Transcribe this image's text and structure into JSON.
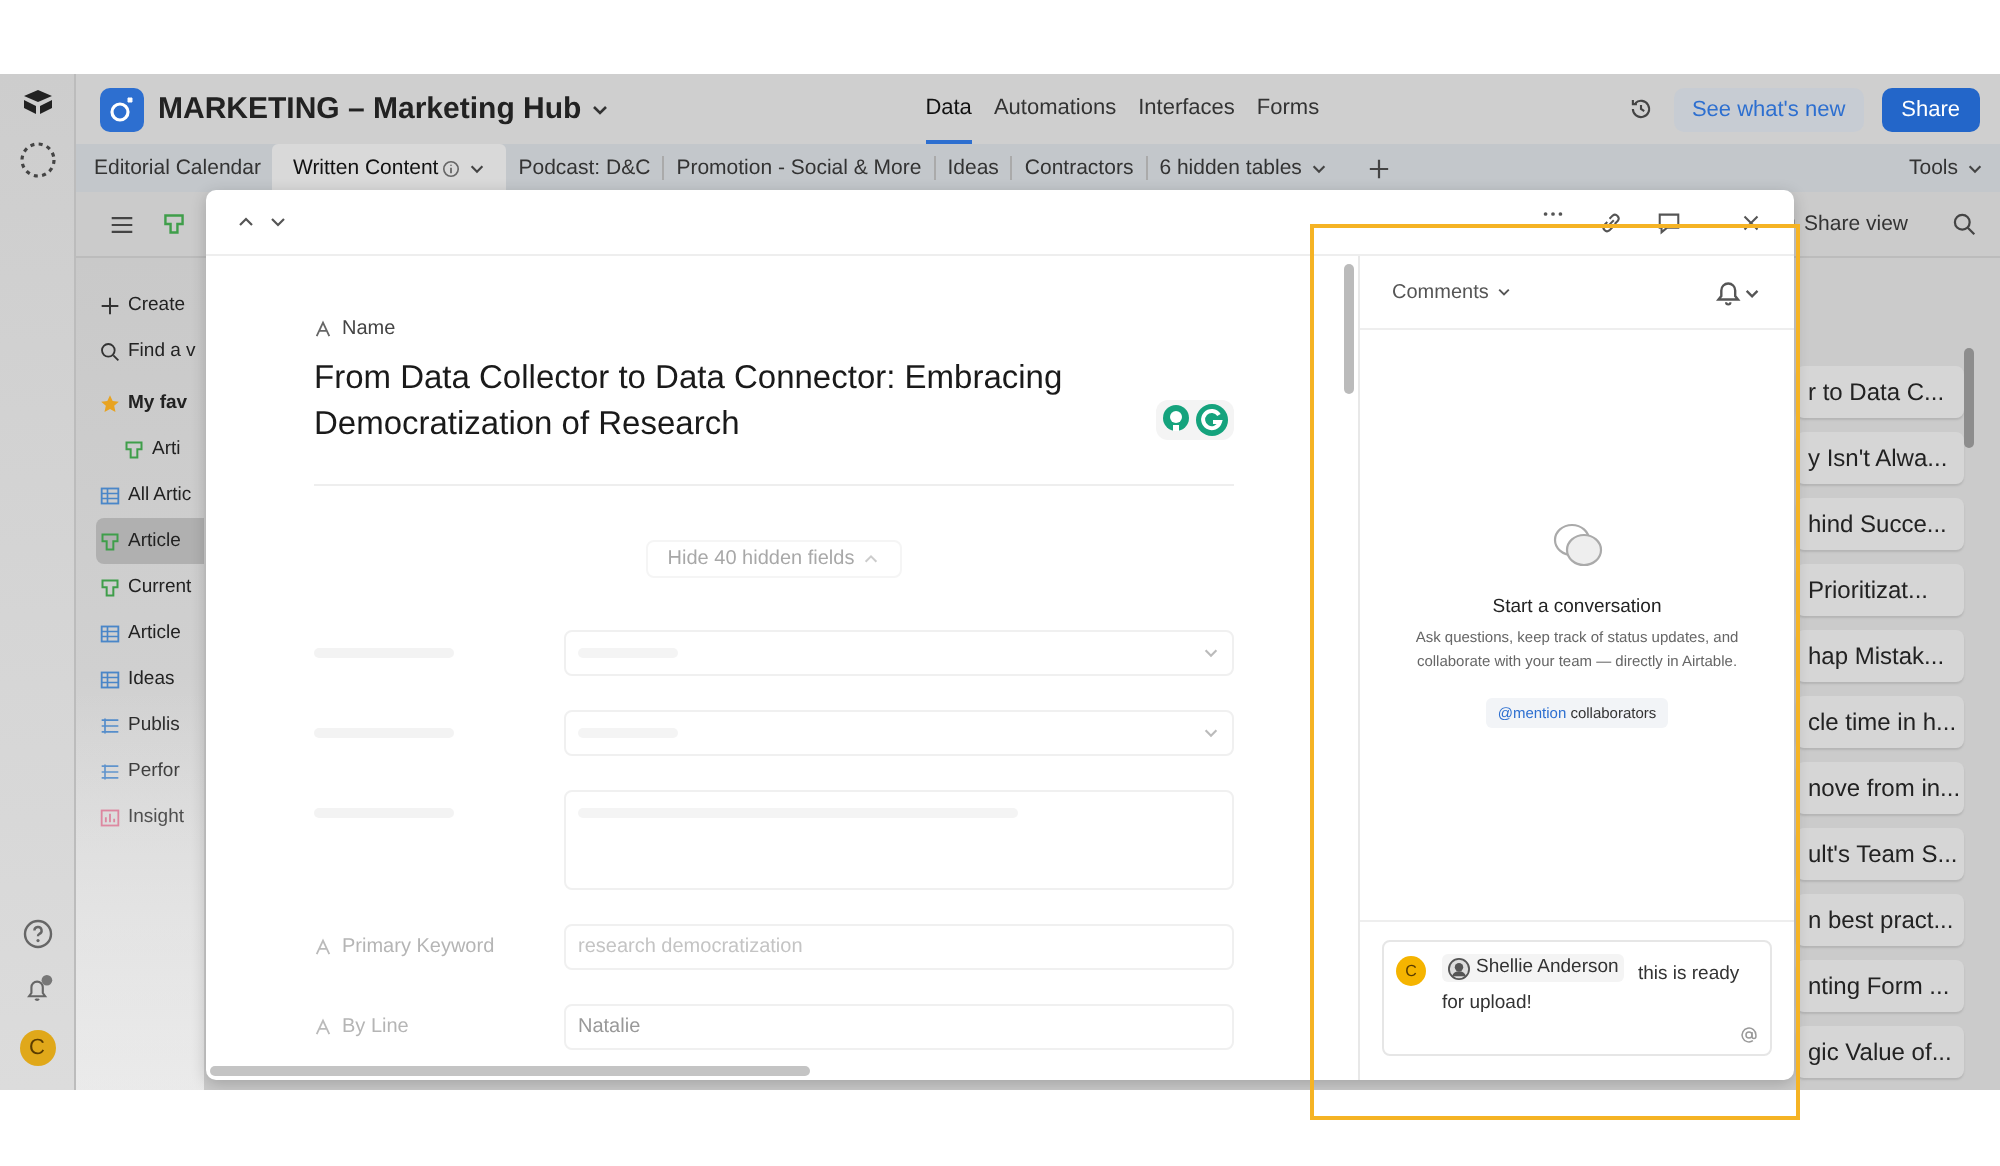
{
  "base": {
    "title": "MARKETING – Marketing Hub"
  },
  "nav": [
    {
      "label": "Data",
      "selected": true
    },
    {
      "label": "Automations",
      "selected": false
    },
    {
      "label": "Interfaces",
      "selected": false
    },
    {
      "label": "Forms",
      "selected": false
    }
  ],
  "header_buttons": {
    "whats_new": "See what's new",
    "share": "Share"
  },
  "tables": [
    {
      "label": "Editorial Calendar",
      "selected": false,
      "kind": "table"
    },
    {
      "label": "Written Content",
      "selected": true,
      "kind": "table"
    },
    {
      "label": "Podcast: D&C",
      "selected": false,
      "kind": "table"
    },
    {
      "label": "Promotion - Social & More",
      "selected": false,
      "kind": "table"
    },
    {
      "label": "Ideas",
      "selected": false,
      "kind": "table"
    },
    {
      "label": "Contractors",
      "selected": false,
      "kind": "table"
    },
    {
      "label": "6 hidden tables",
      "selected": false,
      "kind": "dropdown"
    }
  ],
  "tools": "Tools",
  "view_bar": {
    "share_view": "Share view"
  },
  "sidebar": [
    {
      "label": "Create",
      "kind": "create",
      "selected": false
    },
    {
      "label": "Find a v",
      "kind": "search",
      "selected": false
    },
    {
      "label": "My fav",
      "kind": "favorites",
      "selected": false,
      "children": [
        {
          "label": "Arti",
          "kind": "form",
          "selected": false
        }
      ]
    },
    {
      "label": "All Artic",
      "kind": "grid",
      "selected": false
    },
    {
      "label": "Article",
      "kind": "form",
      "selected": true
    },
    {
      "label": "Current",
      "kind": "form",
      "selected": false
    },
    {
      "label": "Article",
      "kind": "grid",
      "selected": false
    },
    {
      "label": "Ideas",
      "kind": "grid",
      "selected": false
    },
    {
      "label": "Publis",
      "kind": "list",
      "selected": false
    },
    {
      "label": "Perfor",
      "kind": "list",
      "selected": false
    },
    {
      "label": "Insight",
      "kind": "chart",
      "selected": false
    }
  ],
  "rail": {
    "avatar": "C"
  },
  "cells": [
    "r to Data C...",
    "y Isn't Alwa...",
    "hind Succe...",
    "Prioritizat...",
    "hap Mistak...",
    "cle time in h...",
    "nove from in...",
    "ult's Team S...",
    "n best pract...",
    "nting Form ...",
    "gic Value of..."
  ],
  "record": {
    "name_label": "Name",
    "name_value": "From Data Collector to Data Connector: Embracing Democratization of Research",
    "hidden_fields": "Hide 40 hidden fields",
    "fields": [
      {
        "kind": "select"
      },
      {
        "kind": "select"
      },
      {
        "kind": "long_text"
      },
      {
        "kind": "text",
        "label": "Primary Keyword",
        "value": "research democratization"
      },
      {
        "kind": "text",
        "label": "By Line",
        "value": "Natalie"
      }
    ]
  },
  "comments": {
    "title": "Comments",
    "empty_title": "Start a conversation",
    "empty_text": "Ask questions, keep track of status updates, and collaborate with your team — directly in Airtable.",
    "mention_tag": "@mention",
    "mention_rest": "collaborators",
    "composer": {
      "avatar": "C",
      "mention": "Shellie Anderson",
      "text": "this is ready for upload!"
    }
  }
}
